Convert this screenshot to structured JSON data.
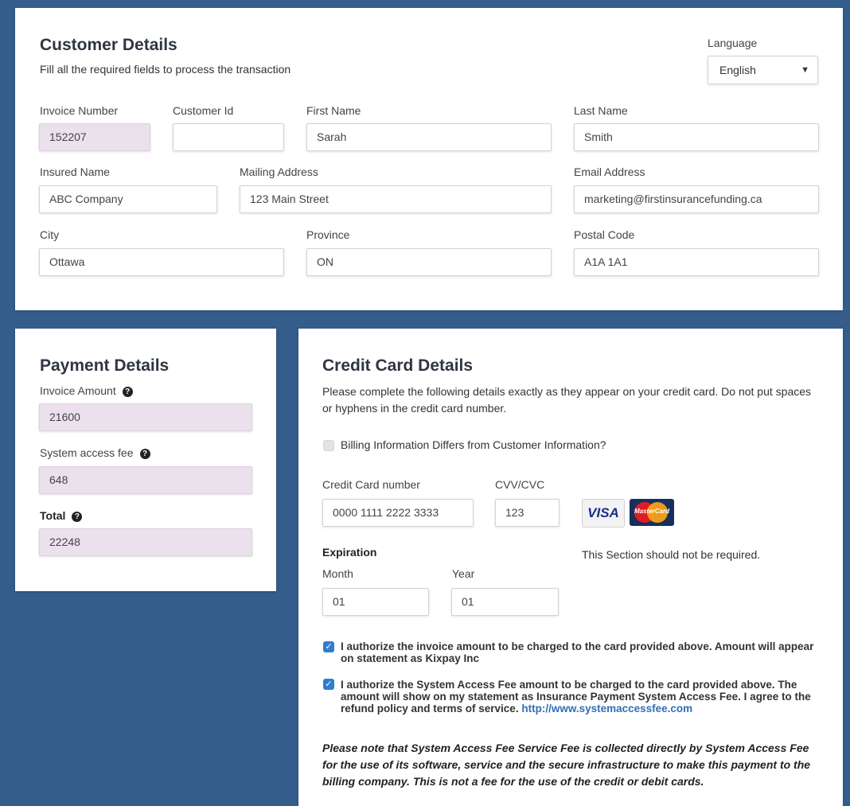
{
  "customer": {
    "title": "Customer Details",
    "subtitle": "Fill all the required fields to process the transaction",
    "language_label": "Language",
    "language_value": "English",
    "fields": {
      "invoice_number": {
        "label": "Invoice Number",
        "value": "152207"
      },
      "customer_id": {
        "label": "Customer Id",
        "value": ""
      },
      "first_name": {
        "label": "First Name",
        "value": "Sarah"
      },
      "last_name": {
        "label": "Last Name",
        "value": "Smith"
      },
      "insured_name": {
        "label": "Insured Name",
        "value": "ABC Company"
      },
      "mailing_address": {
        "label": "Mailing Address",
        "value": "123 Main Street"
      },
      "email": {
        "label": "Email Address",
        "value": "marketing@firstinsurancefunding.ca"
      },
      "city": {
        "label": "City",
        "value": "Ottawa"
      },
      "province": {
        "label": "Province",
        "value": "ON"
      },
      "postal_code": {
        "label": "Postal Code",
        "value": "A1A 1A1"
      }
    }
  },
  "payment": {
    "title": "Payment Details",
    "invoice_amount": {
      "label": "Invoice Amount",
      "value": "21600"
    },
    "system_fee": {
      "label": "System access fee",
      "value": "648"
    },
    "total": {
      "label": "Total",
      "value": "22248"
    }
  },
  "card": {
    "title": "Credit Card Details",
    "instructions": "Please complete the following details exactly as they appear on your credit card. Do not put spaces or hyphens in the credit card number.",
    "billing_differs": "Billing Information Differs from Customer Information?",
    "card_number_label": "Credit Card number",
    "card_number_value": "0000 1111 2222 3333",
    "cvv_label": "CVV/CVC",
    "cvv_value": "123",
    "visa_text": "VISA",
    "mastercard_text": "MasterCard",
    "expiration_label": "Expiration",
    "month_label": "Month",
    "month_value": "01",
    "year_label": "Year",
    "year_value": "01",
    "section_note": "This Section should not be required.",
    "auth1": "I authorize the invoice amount to be charged to the card provided above. Amount will appear on statement as Kixpay Inc",
    "auth2": "I authorize the System Access Fee amount to be charged to the card provided above. The amount will show on my statement as Insurance Payment System Access Fee. I agree to the refund policy and terms of service.",
    "auth2_link": "http://www.systemaccessfee.com",
    "disclaimer": "Please note that System Access Fee Service Fee is collected directly by System Access Fee for the use of its software, service and the secure infrastructure to make this payment to the billing company. This is not a fee for the use of the credit or debit cards."
  }
}
